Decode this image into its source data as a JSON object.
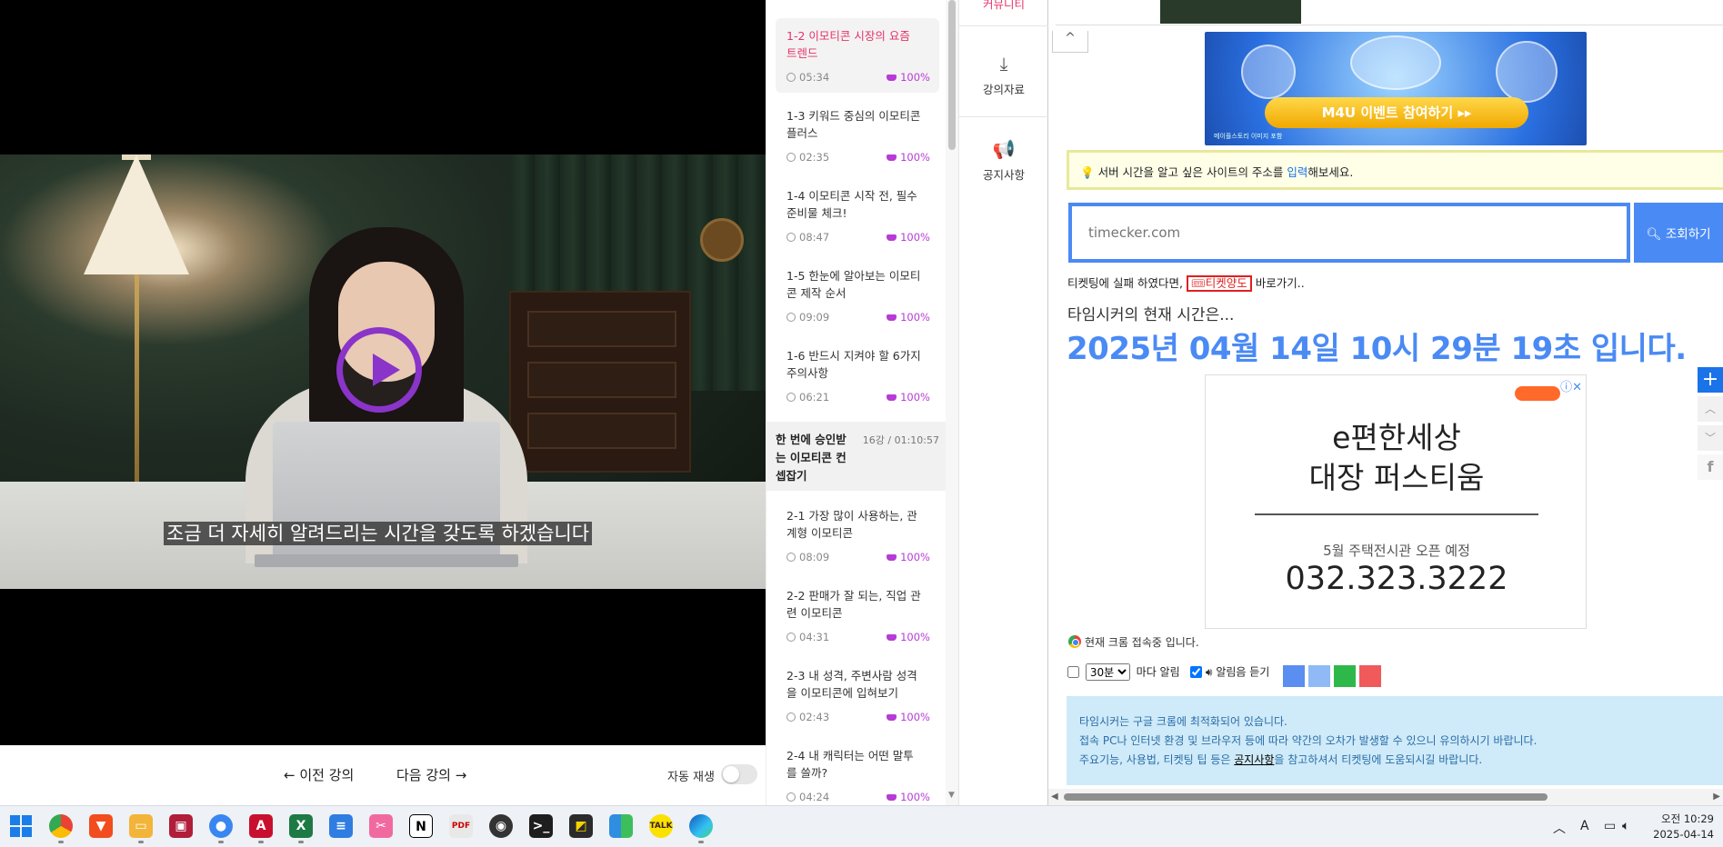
{
  "player": {
    "subtitle": "조금 더 자세히 알려드리는 시간을 갖도록 하겠습니다",
    "prev_label": "이전 강의",
    "next_label": "다음 강의",
    "autoplay_label": "자동 재생",
    "autoplay_on": false
  },
  "lectures": [
    {
      "title": "1-2 이모티콘 시장의 요즘 트렌드",
      "duration": "05:34",
      "progress": "100%",
      "active": true
    },
    {
      "title": "1-3 키워드 중심의 이모티콘 플러스",
      "duration": "02:35",
      "progress": "100%"
    },
    {
      "title": "1-4 이모티콘 시작 전, 필수 준비물 체크!",
      "duration": "08:47",
      "progress": "100%"
    },
    {
      "title": "1-5 한눈에 알아보는 이모티콘 제작 순서",
      "duration": "09:09",
      "progress": "100%"
    },
    {
      "title": "1-6 반드시 지켜야 할 6가지 주의사항",
      "duration": "06:21",
      "progress": "100%"
    }
  ],
  "section2": {
    "title": "한 번에 승인받는 이모티콘 컨셉잡기",
    "meta": "16강 / 01:10:57"
  },
  "lectures2": [
    {
      "title": "2-1 가장 많이 사용하는, 관계형 이모티콘",
      "duration": "08:09",
      "progress": "100%"
    },
    {
      "title": "2-2 판매가 잘 되는, 직업 관련 이모티콘",
      "duration": "04:31",
      "progress": "100%"
    },
    {
      "title": "2-3 내 성격, 주변사람 성격을 이모티콘에 입혀보기",
      "duration": "02:43",
      "progress": "100%"
    },
    {
      "title": "2-4 내 캐릭터는 어떤 말투를 쓸까?",
      "duration": "04:24",
      "progress": "100%"
    }
  ],
  "side_tools": {
    "community": "커뮤니티",
    "materials": "강의자료",
    "notice": "공지사항"
  },
  "browser": {
    "banner_text": "M4U 이벤트 참여하기 ▸▸",
    "banner_fine": "메이플스토리 이미지 포함",
    "hint_prefix": "서버 시간을 알고 싶은 사이트의 주소를 ",
    "hint_link": "입력",
    "hint_suffix": "해보세요.",
    "url_placeholder": "timecker.com",
    "lookup_label": "조회하기",
    "ticket_prefix": "티켓팅에 실패 하였다면,",
    "ticket_badge": "티켓양도",
    "ticket_suffix": "바로가기..",
    "time_caption": "타임시커의 현재 시간은...",
    "time_main": "2025년 04월 14일 10시 29분 19초 입니다.",
    "ad": {
      "line1": "e편한세상",
      "line2": "대장 퍼스티움",
      "line3": "5월 주택전시관 오픈 예정",
      "line4": "032.323.3222"
    },
    "chrome_notice": "현재 크롬 접속중 입니다.",
    "alarm_interval": "30분",
    "alarm_suffix": "마다 알림",
    "alarm_sound": "알림음 듣기",
    "swatches": [
      "#5a8ef0",
      "#8fbaf5",
      "#2fb84a",
      "#f05a5a"
    ],
    "info_line1": "타임시커는 구글 크롬에 최적화되어 있습니다.",
    "info_line2": "접속 PC나 인터넷 환경 및 브라우저 등에 따라 약간의 오차가 발생할 수 있으니 유의하시기 바랍니다.",
    "info_line3_prefix": "주요기능, 사용법, 티켓팅 팁 등은 ",
    "info_line3_link": "공지사항",
    "info_line3_suffix": "을 참고하셔서 티켓팅에 도움되시길 바랍니다."
  },
  "taskbar": {
    "time": "오전 10:29",
    "date": "2025-04-14",
    "ime": "A"
  },
  "colors": {
    "accent_pink": "#e5336a",
    "progress_purple": "#b83bd6",
    "play_purple": "#8a34c9",
    "time_blue": "#4a8af4"
  }
}
